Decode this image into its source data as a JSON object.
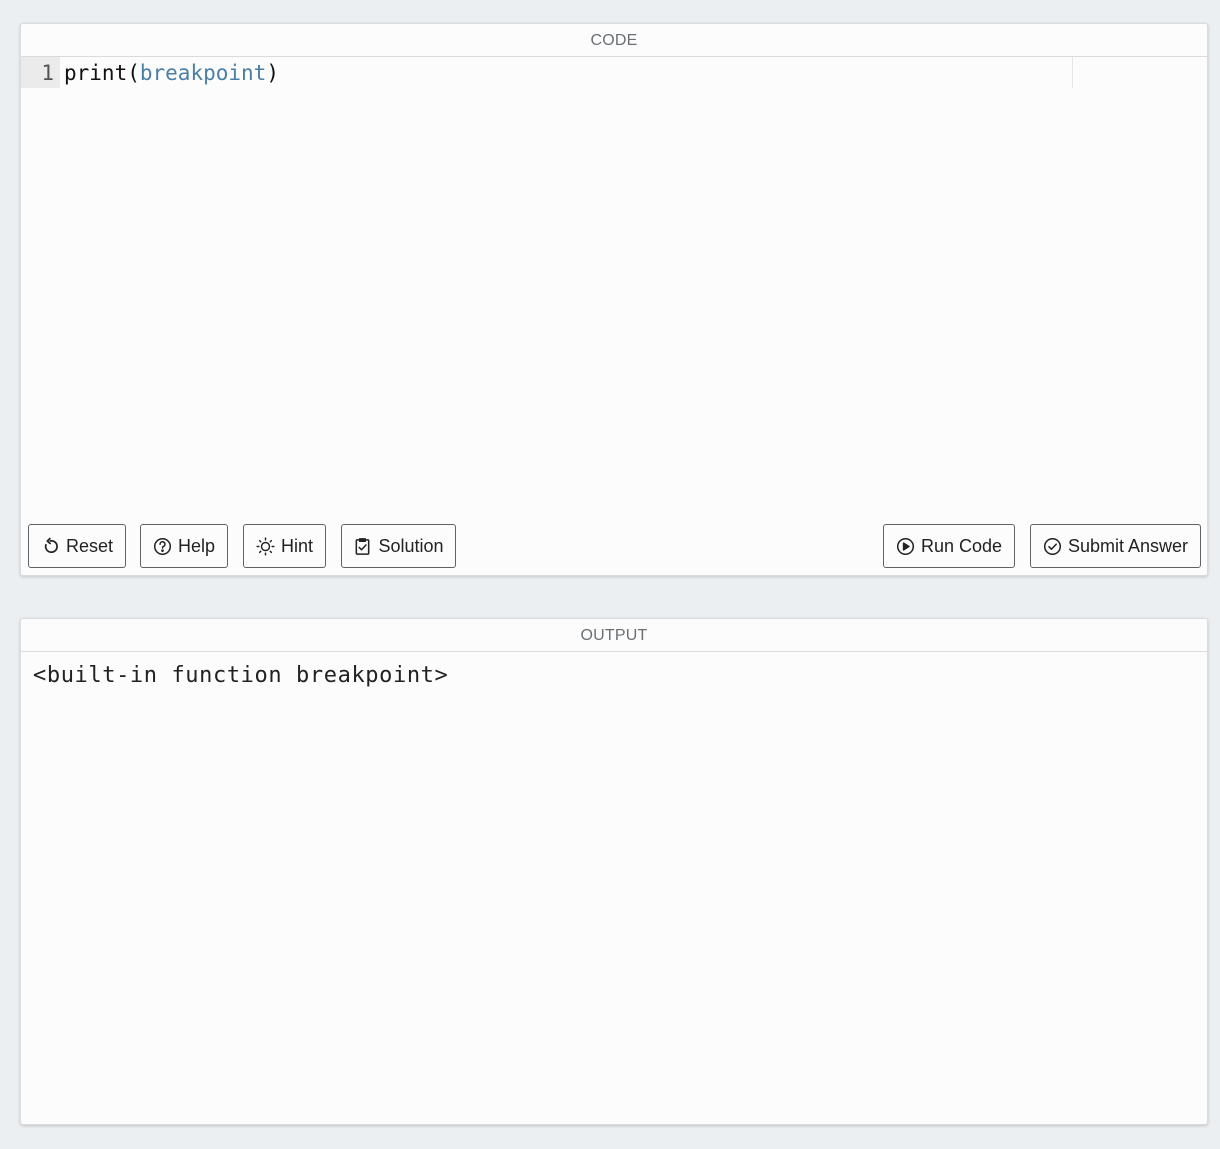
{
  "code_panel": {
    "header": "CODE",
    "editor": {
      "line_number": "1",
      "tokens": {
        "fn": "print",
        "open": "(",
        "arg": "breakpoint",
        "close": ")"
      }
    },
    "buttons": {
      "reset": {
        "label": "Reset",
        "icon": "reset-icon"
      },
      "help": {
        "label": "Help",
        "icon": "help-icon"
      },
      "hint": {
        "label": "Hint",
        "icon": "lightbulb-icon"
      },
      "solution": {
        "label": "Solution",
        "icon": "clipboard-check-icon"
      },
      "run": {
        "label": "Run Code",
        "icon": "play-circle-icon"
      },
      "submit": {
        "label": "Submit Answer",
        "icon": "check-circle-icon"
      }
    }
  },
  "output_panel": {
    "header": "OUTPUT",
    "text": "<built-in function breakpoint>"
  },
  "colors": {
    "background": "#eceff1",
    "panel": "#fcfcfc",
    "identifier": "#4a7fa8",
    "gutter": "#ebebeb"
  }
}
